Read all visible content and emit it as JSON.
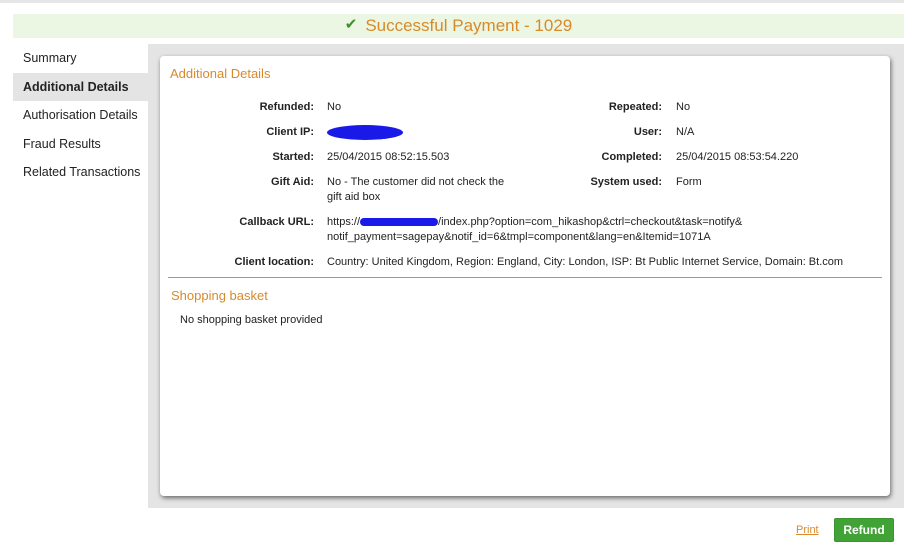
{
  "header": {
    "title": "Successful Payment - 1029",
    "status_icon": "check-icon",
    "status_color": "#3f8f2c"
  },
  "nav": {
    "items": [
      {
        "label": "Summary"
      },
      {
        "label": "Additional Details"
      },
      {
        "label": "Authorisation Details"
      },
      {
        "label": "Fraud Results"
      },
      {
        "label": "Related Transactions"
      }
    ],
    "active": "Additional Details"
  },
  "additional_details": {
    "title": "Additional Details",
    "refunded": {
      "label": "Refunded:",
      "value": "No"
    },
    "repeated": {
      "label": "Repeated:",
      "value": "No"
    },
    "client_ip": {
      "label": "Client IP:",
      "value": ""
    },
    "user": {
      "label": "User:",
      "value": "N/A"
    },
    "started": {
      "label": "Started:",
      "value": "25/04/2015 08:52:15.503"
    },
    "completed": {
      "label": "Completed:",
      "value": "25/04/2015 08:53:54.220"
    },
    "gift_aid": {
      "label": "Gift Aid:",
      "line1": "No - The customer did not check the",
      "line2": "gift aid box"
    },
    "system_used": {
      "label": "System used:",
      "value": "Form"
    },
    "callback_url": {
      "label": "Callback URL:",
      "prefix": "https://",
      "line1_rest": "/index.php?option=com_hikashop&ctrl=checkout&task=notify&",
      "line2": "notif_payment=sagepay&notif_id=6&tmpl=component&lang=en&Itemid=1071A"
    },
    "client_location": {
      "label": "Client location:",
      "value": "Country: United Kingdom, Region: England, City: London, ISP: Bt Public Internet Service, Domain: Bt.com"
    }
  },
  "shopping_basket": {
    "title": "Shopping basket",
    "message": "No shopping basket provided"
  },
  "actions": {
    "print_label": "Print",
    "refund_label": "Refund"
  },
  "colors": {
    "accent": "#d88a2a",
    "banner_bg": "#ebf7e2",
    "button": "#41a335",
    "redaction": "#1a1ae8"
  }
}
